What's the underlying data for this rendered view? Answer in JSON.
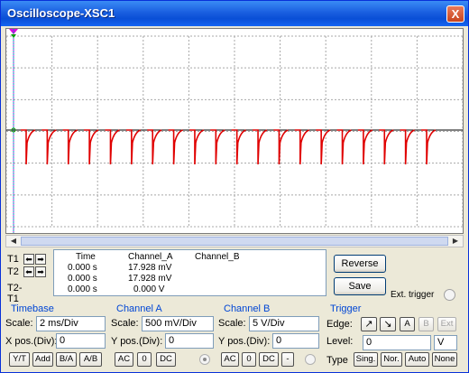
{
  "window": {
    "title": "Oscilloscope-XSC1",
    "close_glyph": "X"
  },
  "display": {
    "background": "#ffffff",
    "grid_color": "#a8a8a8",
    "trace_color": "#e00000",
    "cursor_t1_color": "#e000e0",
    "cursor_t2_color": "#00a0c0",
    "horizontal_divisions": 10,
    "vertical_divisions": 6,
    "spike_count": 20
  },
  "cursors": {
    "t1_label": "T1",
    "t2_label": "T2",
    "t2t1_label": "T2-T1",
    "left_arrow": "⬅",
    "right_arrow": "➡"
  },
  "readout": {
    "headers": [
      "Time",
      "Channel_A",
      "Channel_B"
    ],
    "rows": [
      [
        "0.000 s",
        "17.928 mV",
        ""
      ],
      [
        "0.000 s",
        "17.928 mV",
        ""
      ],
      [
        "0.000 s",
        "0.000 V",
        ""
      ]
    ]
  },
  "buttons": {
    "reverse": "Reverse",
    "save": "Save",
    "ext_trigger": "Ext. trigger"
  },
  "timebase": {
    "title": "Timebase",
    "scale_label": "Scale:",
    "scale_value": "2 ms/Div",
    "xpos_label": "X pos.(Div):",
    "xpos_value": "0",
    "modes": [
      "Y/T",
      "Add",
      "B/A",
      "A/B"
    ]
  },
  "channel_a": {
    "title": "Channel A",
    "scale_label": "Scale:",
    "scale_value": "500 mV/Div",
    "ypos_label": "Y pos.(Div):",
    "ypos_value": "0",
    "coupling": [
      "AC",
      "0",
      "DC"
    ]
  },
  "channel_b": {
    "title": "Channel B",
    "scale_label": "Scale:",
    "scale_value": "5  V/Div",
    "ypos_label": "Y pos.(Div):",
    "ypos_value": "0",
    "coupling": [
      "AC",
      "0",
      "DC",
      "-"
    ]
  },
  "trigger": {
    "title": "Trigger",
    "edge_label": "Edge:",
    "edge_rising": "↗",
    "edge_falling": "↘",
    "sources": [
      "A",
      "B",
      "Ext"
    ],
    "level_label": "Level:",
    "level_value": "0",
    "level_unit": "V",
    "type_label": "Type",
    "types": [
      "Sing.",
      "Nor.",
      "Auto",
      "None"
    ]
  }
}
